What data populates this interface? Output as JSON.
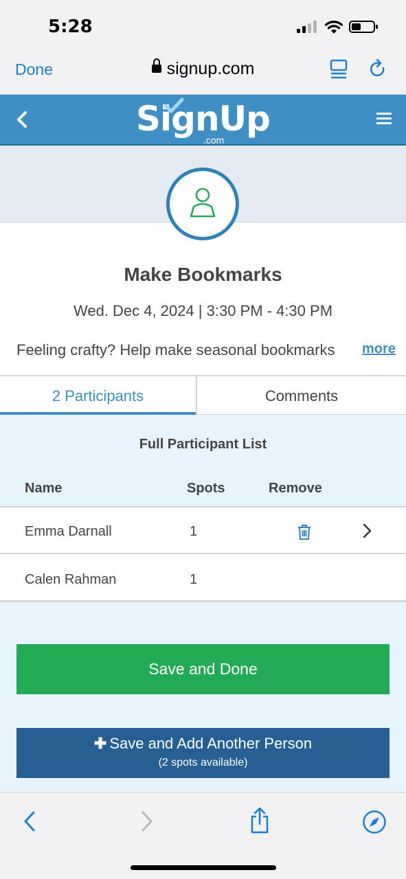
{
  "status_bar": {
    "time": "5:28"
  },
  "browser": {
    "done_label": "Done",
    "url": "signup.com"
  },
  "site_nav": {
    "logo_text": "SignUp",
    "logo_sub": ".com"
  },
  "event": {
    "title": "Make Bookmarks",
    "date": "Wed. Dec 4, 2024 | 3:30 PM - 4:30 PM",
    "description": "Feeling crafty? Help make seasonal bookmarks",
    "more_label": "more"
  },
  "tabs": [
    {
      "label": "2 Participants",
      "active": true
    },
    {
      "label": "Comments",
      "active": false
    }
  ],
  "participant_list": {
    "heading": "Full Participant List",
    "columns": {
      "name": "Name",
      "spots": "Spots",
      "remove": "Remove"
    },
    "rows": [
      {
        "name": "Emma Darnall",
        "spots": "1",
        "removable": true
      },
      {
        "name": "Calen Rahman",
        "spots": "1",
        "removable": false
      }
    ]
  },
  "actions": {
    "save_done_label": "Save and Done",
    "add_another_label": "Save and Add Another Person",
    "spots_available": "(2  spots available)"
  },
  "colors": {
    "brand_blue": "#3d8fc5",
    "save_green": "#22aa55",
    "add_navy": "#275f92",
    "list_bg": "#e7f4fd"
  }
}
